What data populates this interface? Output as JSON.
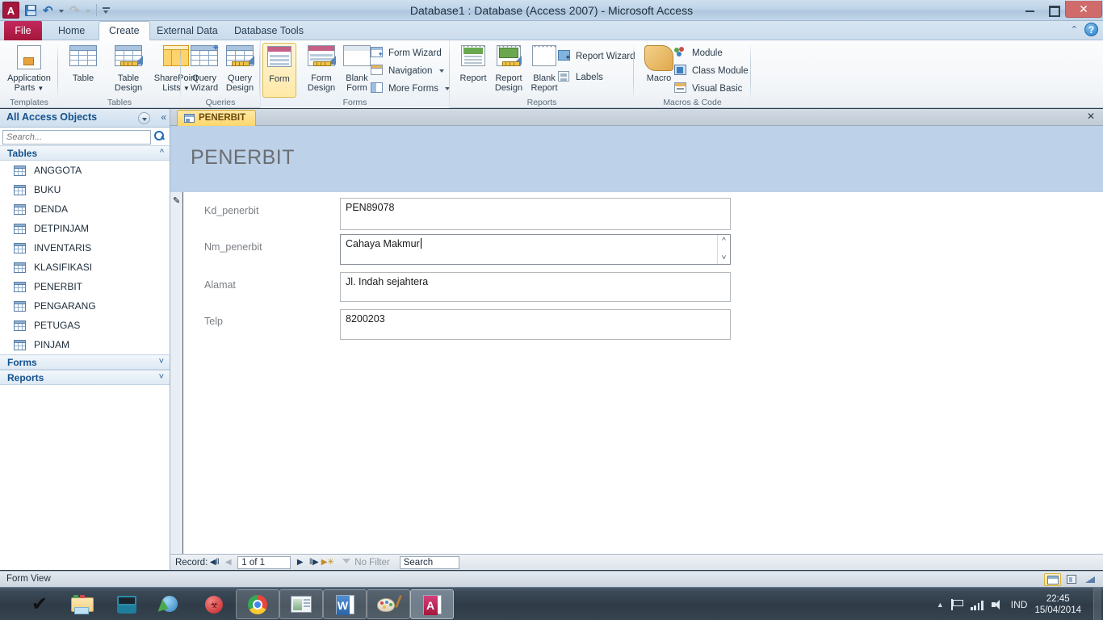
{
  "window": {
    "title": "Database1 : Database (Access 2007)  -  Microsoft Access",
    "logo_text": "A",
    "minimize": "–",
    "restore": "❐",
    "close": "✕"
  },
  "quick_access": {
    "save": "save-icon",
    "undo": "↶",
    "redo": "↷",
    "customize": "customize-qat-icon"
  },
  "ribbon": {
    "tabs": [
      {
        "label": "File",
        "active": false
      },
      {
        "label": "Home",
        "active": false
      },
      {
        "label": "Create",
        "active": true
      },
      {
        "label": "External Data",
        "active": false
      },
      {
        "label": "Database Tools",
        "active": false
      }
    ],
    "help": {
      "collapse": "⌃",
      "help": "?"
    },
    "groups": [
      {
        "name": "Templates",
        "buttons": [
          {
            "label": "Application\nParts",
            "dropdown": true,
            "selected": false
          }
        ],
        "small_buttons": []
      },
      {
        "name": "Tables",
        "buttons": [
          {
            "label": "Table",
            "dropdown": false,
            "selected": false
          },
          {
            "label": "Table\nDesign",
            "dropdown": false,
            "selected": false
          },
          {
            "label": "SharePoint\nLists",
            "dropdown": true,
            "selected": false
          }
        ],
        "small_buttons": []
      },
      {
        "name": "Queries",
        "buttons": [
          {
            "label": "Query\nWizard",
            "dropdown": false,
            "selected": false
          },
          {
            "label": "Query\nDesign",
            "dropdown": false,
            "selected": false
          }
        ],
        "small_buttons": []
      },
      {
        "name": "Forms",
        "buttons": [
          {
            "label": "Form",
            "dropdown": false,
            "selected": true
          },
          {
            "label": "Form\nDesign",
            "dropdown": false,
            "selected": false
          },
          {
            "label": "Blank\nForm",
            "dropdown": false,
            "selected": false
          }
        ],
        "small_buttons": [
          {
            "label": "Form Wizard",
            "dropdown": false
          },
          {
            "label": "Navigation",
            "dropdown": true
          },
          {
            "label": "More Forms",
            "dropdown": true
          }
        ]
      },
      {
        "name": "Reports",
        "buttons": [
          {
            "label": "Report",
            "dropdown": false,
            "selected": false
          },
          {
            "label": "Report\nDesign",
            "dropdown": false,
            "selected": false
          },
          {
            "label": "Blank\nReport",
            "dropdown": false,
            "selected": false
          }
        ],
        "small_buttons": [
          {
            "label": "Report Wizard",
            "dropdown": false
          },
          {
            "label": "Labels",
            "dropdown": false
          }
        ]
      },
      {
        "name": "Macros & Code",
        "buttons": [
          {
            "label": "Macro",
            "dropdown": false,
            "selected": false
          }
        ],
        "small_buttons": [
          {
            "label": "Module",
            "dropdown": false
          },
          {
            "label": "Class Module",
            "dropdown": false
          },
          {
            "label": "Visual Basic",
            "dropdown": false
          }
        ]
      }
    ]
  },
  "nav_pane": {
    "title": "All Access Objects",
    "search_placeholder": "Search...",
    "search_value": "",
    "groups": [
      {
        "label": "Tables",
        "expanded": true,
        "items": [
          "ANGGOTA",
          "BUKU",
          "DENDA",
          "DETPINJAM",
          "INVENTARIS",
          "KLASIFIKASI",
          "PENERBIT",
          "PENGARANG",
          "PETUGAS",
          "PINJAM"
        ]
      },
      {
        "label": "Forms",
        "expanded": false,
        "items": []
      },
      {
        "label": "Reports",
        "expanded": false,
        "items": []
      }
    ]
  },
  "document": {
    "tab_label": "PENERBIT",
    "close_label": "✕",
    "form_title": "PENERBIT",
    "record_indicator": "✎",
    "fields": [
      {
        "label": "Kd_penerbit",
        "value": "PEN89078",
        "focused": false,
        "has_scrollbar": false
      },
      {
        "label": "Nm_penerbit",
        "value": "Cahaya Makmur",
        "focused": true,
        "has_scrollbar": true
      },
      {
        "label": "Alamat",
        "value": "Jl. Indah sejahtera",
        "focused": false,
        "has_scrollbar": false
      },
      {
        "label": "Telp",
        "value": "8200203",
        "focused": false,
        "has_scrollbar": false
      }
    ]
  },
  "record_nav": {
    "label": "Record:",
    "first": "◀‖",
    "prev": "◀",
    "position": "1 of 1",
    "next": "▶",
    "last": "‖▶",
    "new": "▶✳",
    "filter_status": "No Filter",
    "search_placeholder": "Search",
    "search_value": "Search"
  },
  "status_bar": {
    "text": "Form View",
    "views": [
      {
        "name": "form-view",
        "active": true
      },
      {
        "name": "layout-view",
        "active": false
      },
      {
        "name": "design-view",
        "active": false
      }
    ]
  },
  "taskbar": {
    "items": [
      {
        "name": "checkmark-icon",
        "glyph": "✔",
        "state": "pinned"
      },
      {
        "name": "folder-explorer-icon",
        "glyph": "",
        "state": "pinned"
      },
      {
        "name": "device-emulator-icon",
        "glyph": "",
        "state": "pinned"
      },
      {
        "name": "internet-download-manager-icon",
        "glyph": "",
        "state": "pinned"
      },
      {
        "name": "antivirus-icon",
        "glyph": "",
        "state": "pinned"
      },
      {
        "name": "google-chrome-icon",
        "glyph": "",
        "state": "running"
      },
      {
        "name": "presentation-icon",
        "glyph": "",
        "state": "running"
      },
      {
        "name": "microsoft-word-icon",
        "glyph": "W",
        "state": "running"
      },
      {
        "name": "paint-icon",
        "glyph": "",
        "state": "running"
      },
      {
        "name": "microsoft-access-icon",
        "glyph": "A",
        "state": "active"
      }
    ],
    "tray": {
      "language": "IND",
      "time": "22:45",
      "date": "15/04/2014"
    }
  },
  "colors": {
    "accent_red": "#a4173c",
    "form_header": "#bdd1e8",
    "tab_gold": "#fdd66a",
    "nav_title_blue": "#15518c"
  }
}
